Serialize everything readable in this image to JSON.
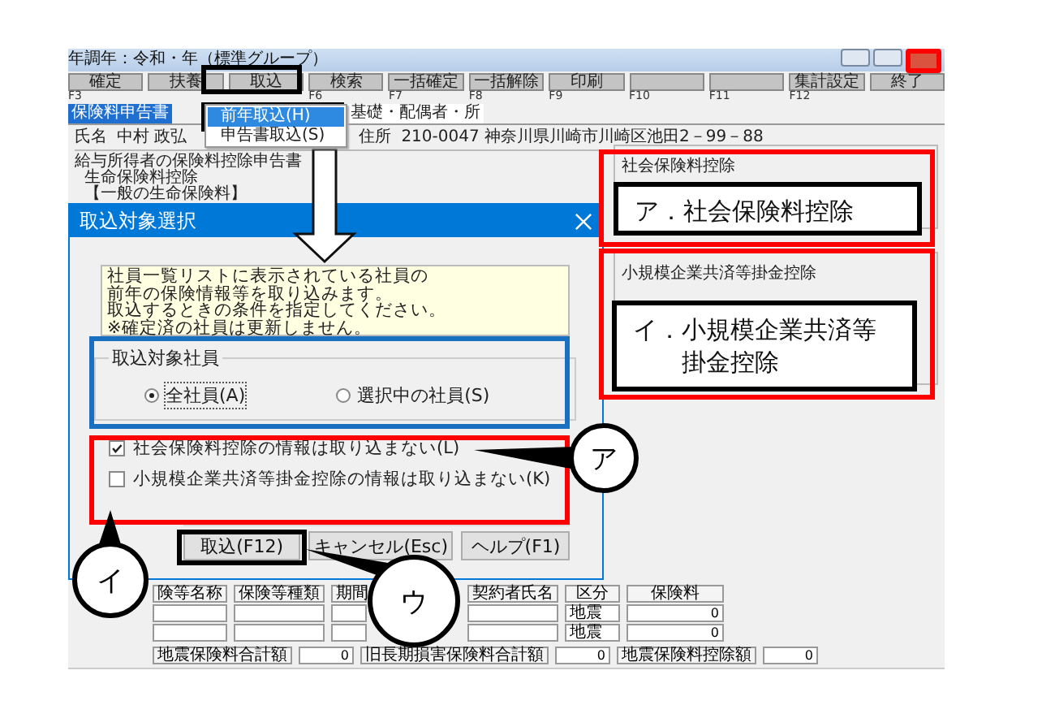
{
  "app_window": {
    "title": "年調年：令和・年（標準グループ）",
    "toolbar": [
      {
        "kind": "command",
        "label": "確定",
        "key": "F3"
      },
      {
        "kind": "command",
        "label": "扶養"
      },
      {
        "kind": "command",
        "label": "取込"
      },
      {
        "kind": "command",
        "label": "検索",
        "key": "F6"
      },
      {
        "kind": "command",
        "label": "一括確定",
        "key": "F7"
      },
      {
        "kind": "command",
        "label": "一括解除",
        "key": "F8"
      },
      {
        "kind": "command",
        "label": "印刷",
        "key": "F9"
      },
      {
        "kind": "blank",
        "key": "F10"
      },
      {
        "kind": "blank",
        "key": "F11"
      },
      {
        "kind": "command",
        "label": "集計設定",
        "key": "F12"
      },
      {
        "kind": "command",
        "label": "終了"
      }
    ],
    "tabs": [
      {
        "label": "保険料申告書",
        "selected": true
      },
      {
        "label": "基礎・配偶者・所",
        "selected": false
      }
    ],
    "menu": [
      {
        "label": "前年取込(H)",
        "selected": true
      },
      {
        "label": "申告書取込(S)",
        "selected": false
      }
    ],
    "employee": {
      "name_label": "氏名",
      "name": "中村 政弘",
      "address_label": "住所",
      "address": "210-0047 神奈川県川崎市川崎区池田2－99－88"
    },
    "left_section": {
      "title": "給与所得者の保険料控除申告書",
      "subtitle": "生命保険料控除",
      "heading": "【一般の生命保険料】"
    },
    "right_groups": [
      "社会保険料控除",
      "小規模企業共済等掛金控除"
    ],
    "insurance_table": {
      "columns": [
        "険等名称",
        "保険等種類",
        "期間",
        "契約者氏名",
        "区分",
        "保険料"
      ],
      "rows": [
        {
          "category": "地震",
          "amount": "0"
        },
        {
          "category": "地震",
          "amount": "0"
        }
      ],
      "totals": [
        {
          "label": "地震保険料合計額",
          "value": "0"
        },
        {
          "label": "旧長期損害保険料合計額",
          "value": "0"
        },
        {
          "label": "地震保険料控除額",
          "value": "0"
        }
      ]
    }
  },
  "dialog": {
    "title": "取込対象選択",
    "info_lines": [
      "社員一覧リストに表示されている社員の",
      "前年の保険情報等を取り込みます。",
      "取込するときの条件を指定してください。",
      "※確定済の社員は更新しません。"
    ],
    "group_title": "取込対象社員",
    "radios": [
      {
        "label": "全社員(A)",
        "selected": true
      },
      {
        "label": "選択中の社員(S)",
        "selected": false
      }
    ],
    "checkboxes": [
      {
        "label": "社会保険料控除の情報は取り込まない(L)",
        "checked": true
      },
      {
        "label": "小規模企業共済等掛金控除の情報は取り込まない(K)",
        "checked": false
      }
    ],
    "buttons": [
      "取込(F12)",
      "キャンセル(Esc)",
      "ヘルプ(F1)"
    ]
  },
  "notes": [
    {
      "mark": "ア．",
      "text": "社会保険料控除"
    },
    {
      "mark": "イ．",
      "text": "小規模企業共済等掛金控除"
    }
  ],
  "callouts": [
    "ア",
    "イ",
    "ウ"
  ]
}
